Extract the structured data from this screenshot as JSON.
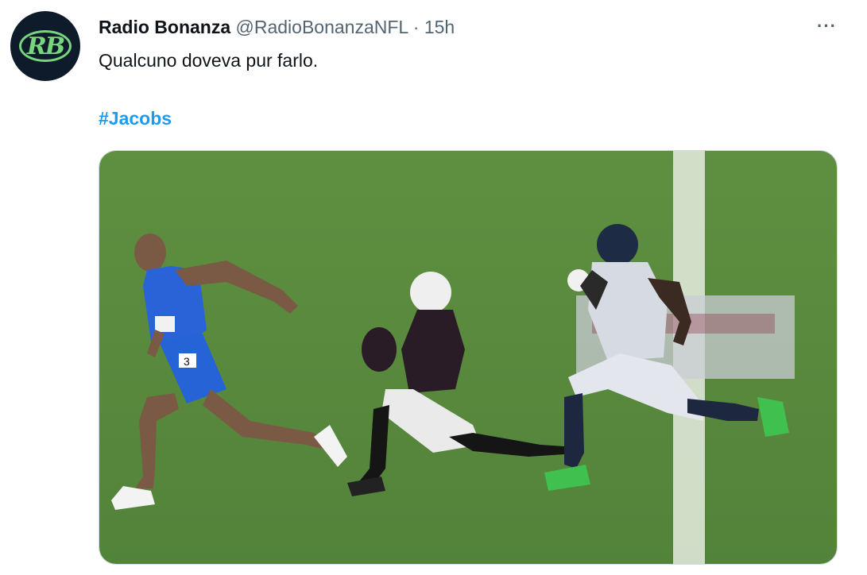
{
  "tweet": {
    "avatar_icon": "radio-bonanza-logo",
    "avatar_text": "RB",
    "display_name": "Radio Bonanza",
    "handle": "@RadioBonanzaNFL",
    "separator": "·",
    "timestamp": "15h",
    "more_icon": "more-dots-icon",
    "more_label": "···",
    "text": "Qualcuno doveva pur farlo.",
    "hashtag": "#Jacobs"
  },
  "media": {
    "description_icon": "photo-image",
    "runner_bib": "3"
  },
  "colors": {
    "hashtag": "#1d9bf0",
    "secondary_text": "#536471",
    "avatar_bg": "#0d1b2a",
    "avatar_accent": "#79d57d",
    "field": "#5b8a3e"
  }
}
